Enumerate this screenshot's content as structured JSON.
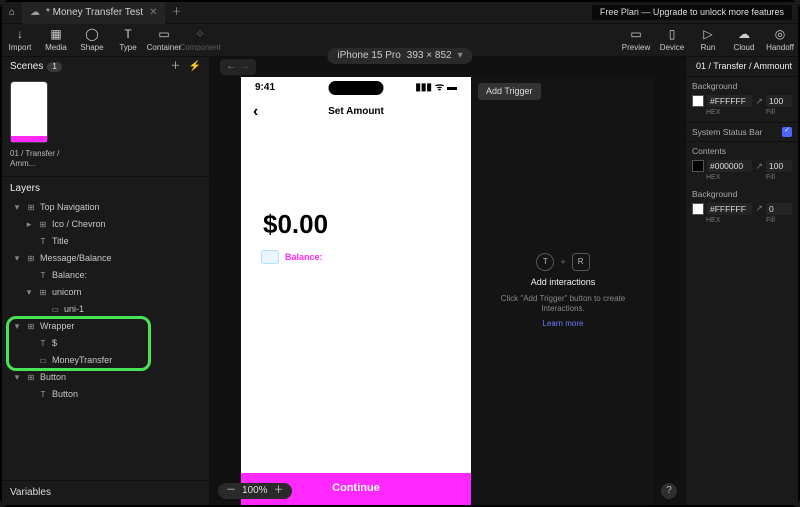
{
  "tab": {
    "title": "* Money Transfer Test",
    "icon": "cloud"
  },
  "free_plan": "Free Plan — Upgrade to unlock more features",
  "device": {
    "name": "iPhone 15 Pro",
    "dims": "393 × 852"
  },
  "tools_left": [
    {
      "label": "Import",
      "icon": "↓"
    },
    {
      "label": "Media",
      "icon": "▦"
    },
    {
      "label": "Shape",
      "icon": "◯"
    },
    {
      "label": "Type",
      "icon": "T"
    },
    {
      "label": "Container",
      "icon": "▭"
    },
    {
      "label": "Component",
      "icon": "✧"
    }
  ],
  "tools_right": [
    {
      "label": "Preview",
      "icon": "▭"
    },
    {
      "label": "Device",
      "icon": "▯"
    },
    {
      "label": "Run",
      "icon": "▷"
    },
    {
      "label": "Cloud",
      "icon": "☁"
    },
    {
      "label": "Handoff",
      "icon": "◎"
    }
  ],
  "scenes": {
    "title": "Scenes",
    "count": "1",
    "thumb_label": "01 / Transfer / Amm..."
  },
  "layers_title": "Layers",
  "tree": [
    {
      "ind": 1,
      "arr": "▾",
      "t": "⊞",
      "label": "Top Navigation"
    },
    {
      "ind": 2,
      "arr": "▸",
      "t": "⊞",
      "label": "Ico / Chevron"
    },
    {
      "ind": 2,
      "arr": "",
      "t": "T",
      "label": "Title"
    },
    {
      "ind": 1,
      "arr": "▾",
      "t": "⊞",
      "label": "Message/Balance"
    },
    {
      "ind": 2,
      "arr": "",
      "t": "T",
      "label": "Balance:"
    },
    {
      "ind": 2,
      "arr": "▾",
      "t": "⊞",
      "label": "unicorn"
    },
    {
      "ind": 3,
      "arr": "",
      "t": "▭",
      "label": "uni-1"
    },
    {
      "ind": 1,
      "arr": "▾",
      "t": "⊞",
      "label": "Wrapper"
    },
    {
      "ind": 2,
      "arr": "",
      "t": "T",
      "label": "$"
    },
    {
      "ind": 2,
      "arr": "",
      "t": "▭",
      "label": "MoneyTransfer"
    },
    {
      "ind": 1,
      "arr": "▾",
      "t": "⊞",
      "label": "Button"
    },
    {
      "ind": 2,
      "arr": "",
      "t": "T",
      "label": "Button"
    }
  ],
  "tree_highlight": {
    "start": 7,
    "end": 9
  },
  "variables_title": "Variables",
  "zoom": "100%",
  "phone": {
    "time": "9:41",
    "title": "Set Amount",
    "amount": "$0.00",
    "balance_label": "Balance:",
    "cta": "Continue"
  },
  "interactions": {
    "add_trigger": "Add Trigger",
    "title": "Add interactions",
    "sub": "Click \"Add Trigger\" button to create Interactions.",
    "learn": "Learn more"
  },
  "inspector": {
    "path": "01 / Transfer / Ammount",
    "bg": {
      "label": "Background",
      "hex": "#FFFFFF",
      "fill": "100"
    },
    "status": {
      "label": "System Status Bar",
      "checked": true
    },
    "contents": {
      "label": "Contents",
      "hex": "#000000",
      "fill": "100"
    },
    "bg2": {
      "label": "Background",
      "hex": "#FFFFFF",
      "fill": "0"
    },
    "sub_hex": "HEX",
    "sub_fill": "Fill"
  }
}
